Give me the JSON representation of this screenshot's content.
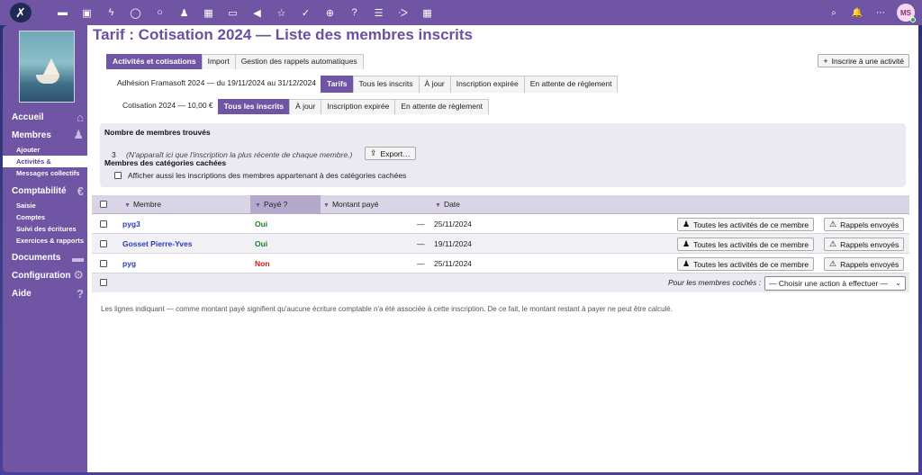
{
  "topbar": {
    "logo_glyph": "✗",
    "app_icons": [
      "▬",
      "▣",
      "ϟ",
      "◯",
      "○",
      "♟",
      "▦",
      "▭",
      "◀",
      "☆",
      "✓",
      "⊕",
      "?",
      "☰",
      "ᐧᐳ",
      "▦"
    ],
    "right_icons": [
      "⌕",
      "🔔",
      "⋯"
    ],
    "avatar_initials": "MS"
  },
  "sidebar": {
    "items": [
      {
        "label": "Accueil",
        "icon": "home-icon",
        "glyph": "⌂"
      },
      {
        "label": "Membres",
        "icon": "users-icon",
        "glyph": "♟"
      },
      {
        "label": "Ajouter"
      },
      {
        "label": "Activités & cotisations"
      },
      {
        "label": "Messages collectifs"
      },
      {
        "label": "Comptabilité",
        "icon": "euro-icon",
        "glyph": "€"
      },
      {
        "label": "Saisie"
      },
      {
        "label": "Comptes"
      },
      {
        "label": "Suivi des écritures"
      },
      {
        "label": "Exercices & rapports"
      },
      {
        "label": "Documents",
        "icon": "folder-icon",
        "glyph": "▬"
      },
      {
        "label": "Configuration",
        "icon": "gear-icon",
        "glyph": "⚙"
      },
      {
        "label": "Aide",
        "icon": "help-icon",
        "glyph": "?"
      }
    ]
  },
  "page": {
    "title": "Tarif : Cotisation 2024 — Liste des membres inscrits",
    "add_button": "Inscrire à une activité",
    "add_icon": "+"
  },
  "tabs1": [
    "Activités et cotisations",
    "Import",
    "Gestion des rappels automatiques"
  ],
  "tabs2": [
    "Adhésion Framasoft 2024 — du 19/11/2024 au 31/12/2024",
    "Tarifs",
    "Tous les inscrits",
    "À jour",
    "Inscription expirée",
    "En attente de règlement"
  ],
  "tabs3": [
    "Cotisation 2024 — 10,00 €",
    "Tous les inscrits",
    "À jour",
    "Inscription expirée",
    "En attente de règlement"
  ],
  "info": {
    "found_heading": "Nombre de membres trouvés",
    "count": "3",
    "note": "(N'apparaît ici que l'inscription la plus récente de chaque membre.)",
    "export_label": "Export…",
    "hidden_heading": "Membres des catégories cachées",
    "hidden_checkbox": "Afficher aussi les inscriptions des membres appartenant à des catégories cachées"
  },
  "table": {
    "headers": [
      "Membre",
      "Payé ?",
      "Montant payé",
      "Date"
    ],
    "rows": [
      {
        "member": "pyg3",
        "paid": "Oui",
        "amount": "—",
        "date": "25/11/2024",
        "btn1": "Toutes les activités de ce membre",
        "btn2": "Rappels envoyés"
      },
      {
        "member": "Gosset Pierre-Yves",
        "paid": "Oui",
        "amount": "—",
        "date": "19/11/2024",
        "btn1": "Toutes les activités de ce membre",
        "btn2": "Rappels envoyés"
      },
      {
        "member": "pyg",
        "paid": "Non",
        "amount": "—",
        "date": "25/11/2024",
        "btn1": "Toutes les activités de ce membre",
        "btn2": "Rappels envoyés"
      }
    ],
    "footer_label": "Pour les membres cochés :",
    "footer_select": "— Choisir une action à effectuer —"
  },
  "footnote": "Les lignes indiquant — comme montant payé signifient qu'aucune écriture comptable n'a été associée à cette inscription. De ce fait, le montant restant à payer ne peut être calculé."
}
